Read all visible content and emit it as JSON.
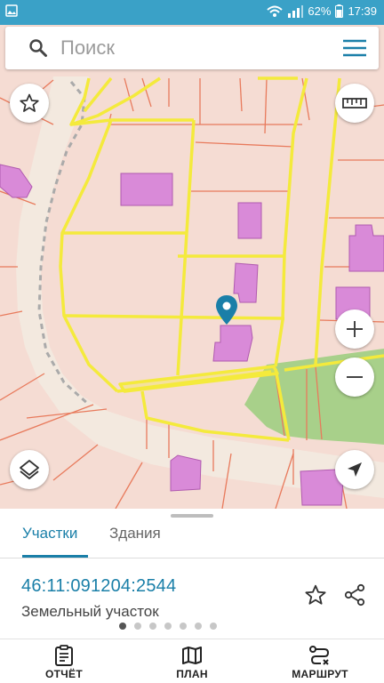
{
  "status_bar": {
    "battery": "62%",
    "time": "17:39",
    "icons": [
      "image-icon",
      "wifi-icon",
      "signal-icon",
      "battery-icon"
    ]
  },
  "search": {
    "placeholder": "Поиск"
  },
  "map": {
    "controls": [
      "favorite-star-icon",
      "ruler-icon",
      "zoom-in-icon",
      "zoom-out-icon",
      "layers-icon",
      "my-location-icon"
    ],
    "marker": "location-pin-icon",
    "colors": {
      "background": "#f5dcd3",
      "parcel_border": "#e87a5c",
      "highlight": "#f4ea3c",
      "building": "#d98ad8",
      "greenery": "#a8d08a",
      "road": "#f3e9df",
      "accent": "#1a7fa8"
    }
  },
  "bottom_sheet": {
    "tabs": [
      {
        "label": "Участки",
        "active": true
      },
      {
        "label": "Здания",
        "active": false
      }
    ],
    "cadastral_number": "46:11:091204:2544",
    "object_type": "Земельный участок",
    "pager": {
      "count": 7,
      "active_index": 0
    }
  },
  "bottom_nav": {
    "items": [
      {
        "label": "ОТЧЁТ",
        "icon": "report-clipboard-icon"
      },
      {
        "label": "ПЛАН",
        "icon": "map-plan-icon"
      },
      {
        "label": "МАРШРУТ",
        "icon": "route-icon"
      }
    ]
  }
}
